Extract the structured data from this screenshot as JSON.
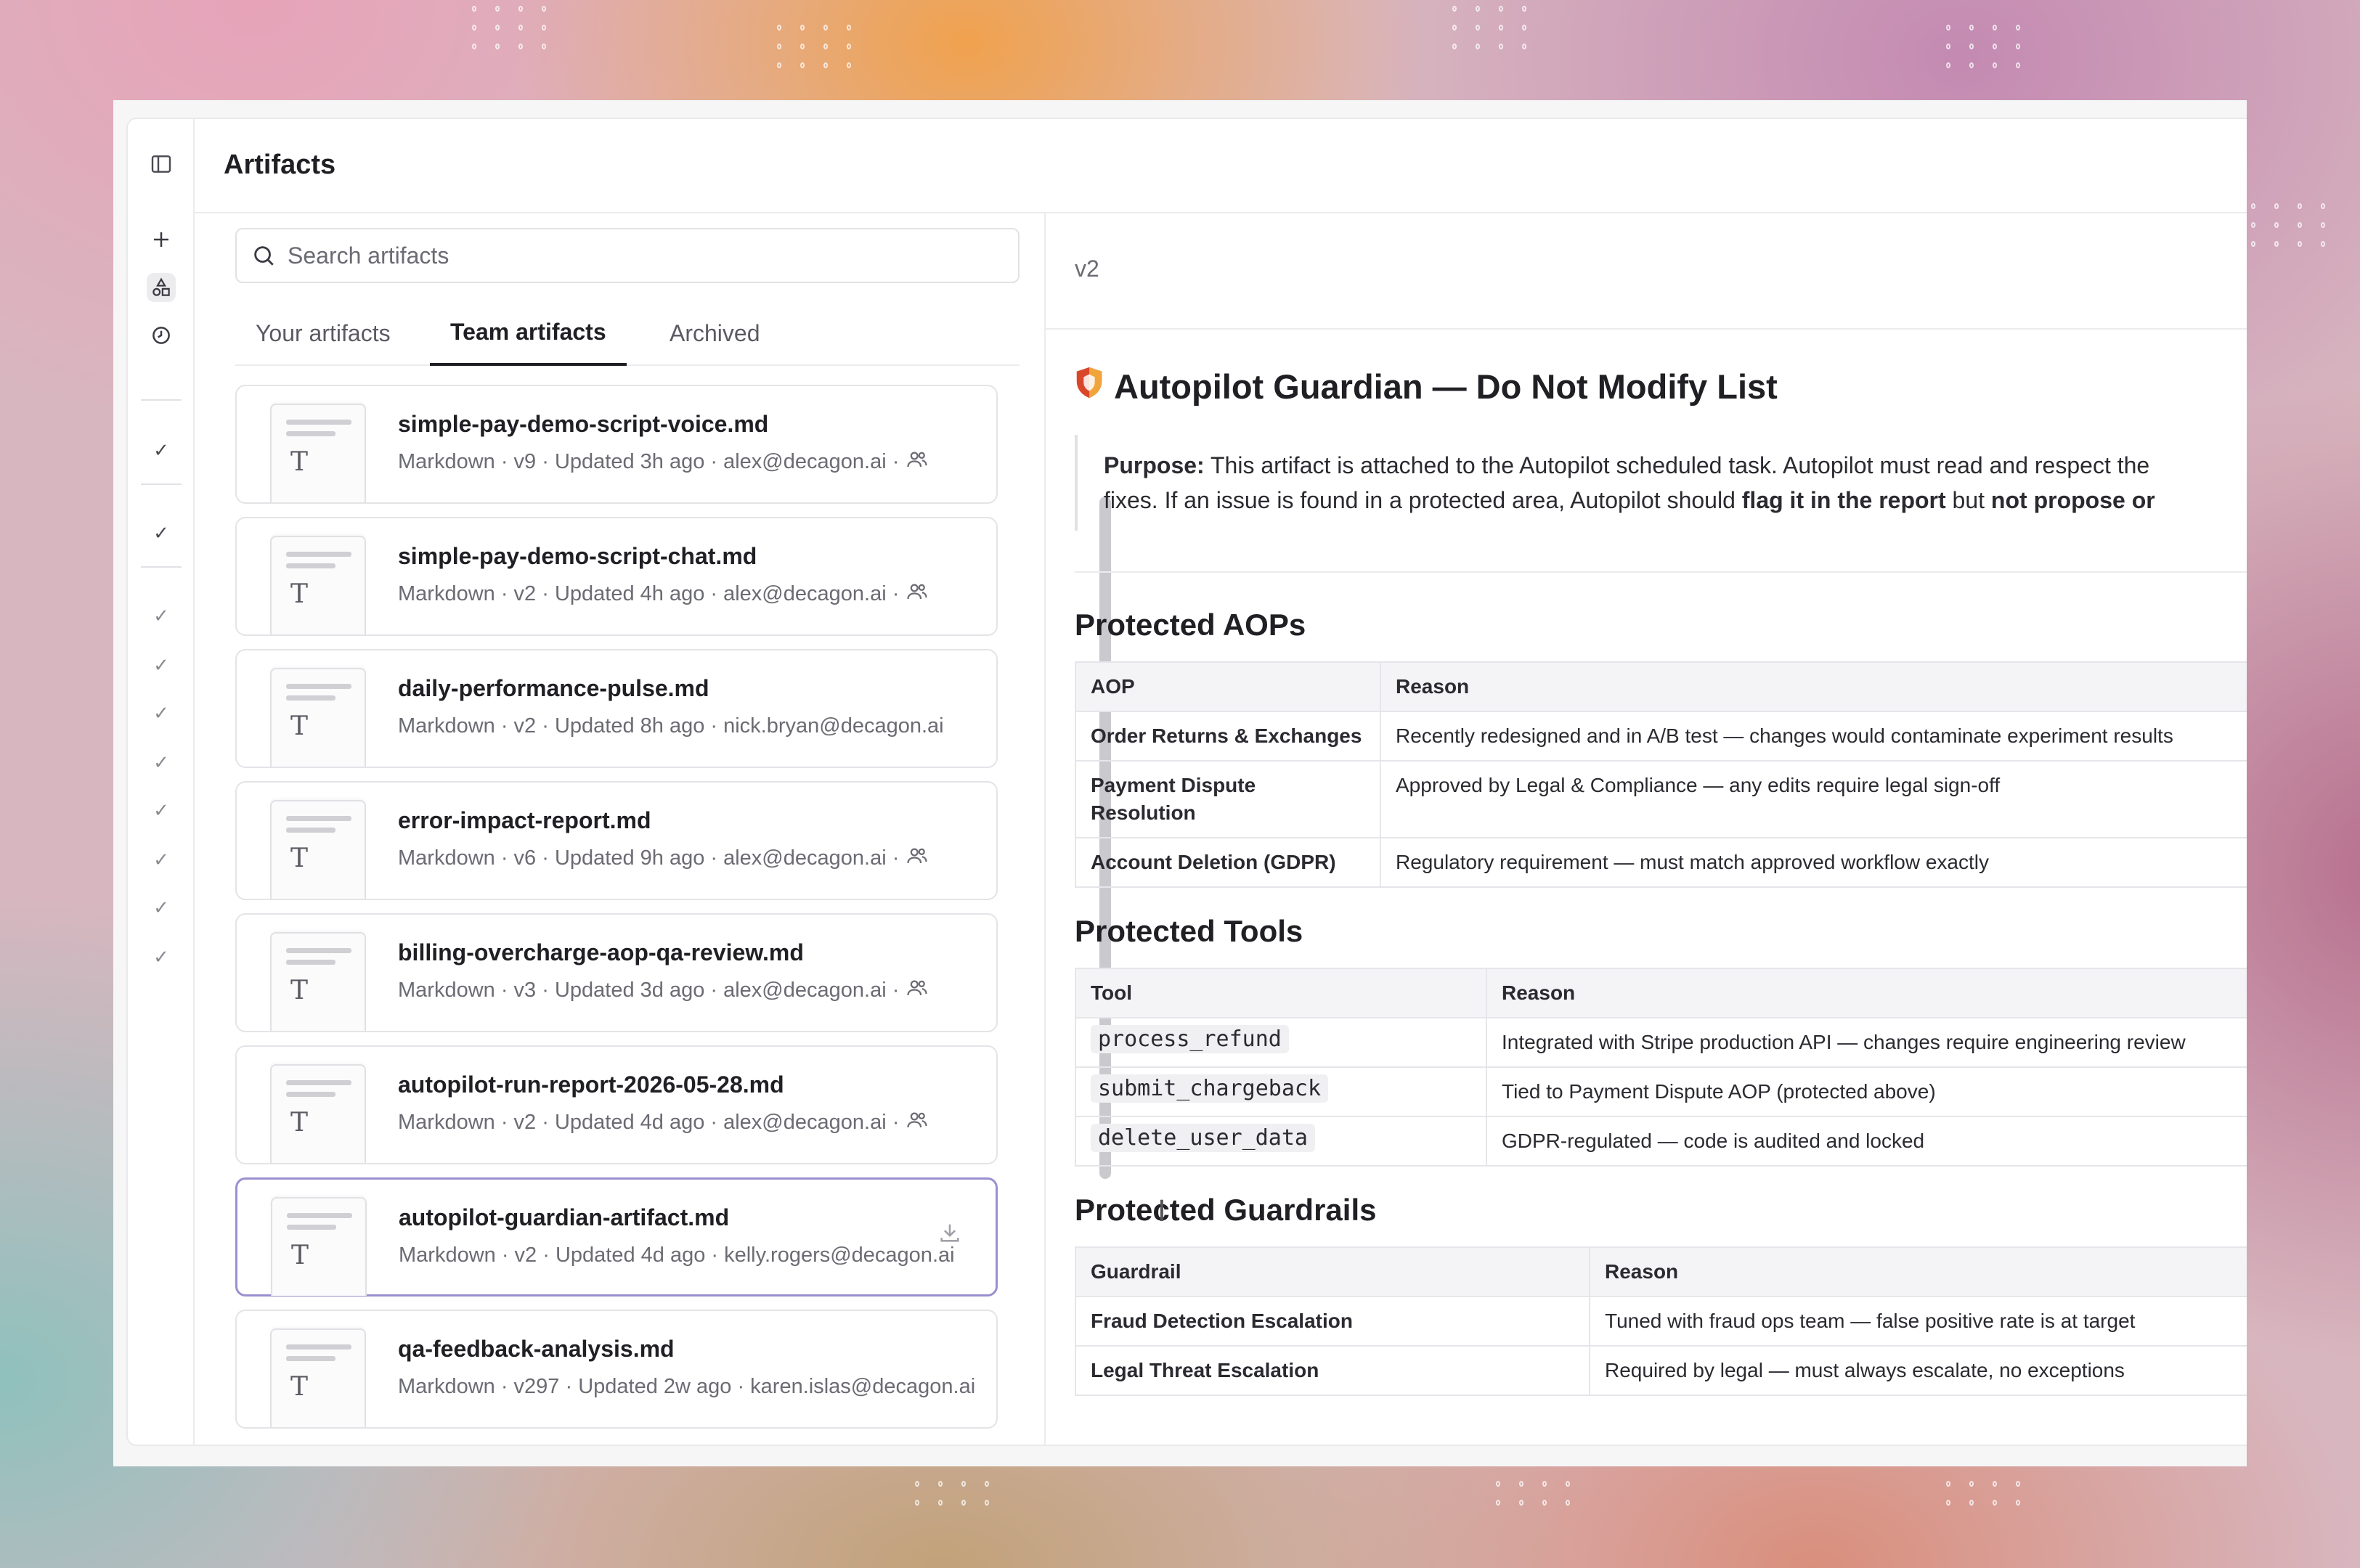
{
  "header": {
    "title": "Artifacts"
  },
  "search": {
    "placeholder": "Search artifacts"
  },
  "tabs": [
    {
      "label": "Your artifacts"
    },
    {
      "label": "Team artifacts",
      "active": true
    },
    {
      "label": "Archived"
    }
  ],
  "artifacts": [
    {
      "name": "simple-pay-demo-script-voice.md",
      "meta": "Markdown · v9 · Updated 3h ago · alex@decagon.ai ·",
      "shared": true
    },
    {
      "name": "simple-pay-demo-script-chat.md",
      "meta": "Markdown · v2 · Updated 4h ago · alex@decagon.ai ·",
      "shared": true
    },
    {
      "name": "daily-performance-pulse.md",
      "meta": "Markdown · v2 · Updated 8h ago · nick.bryan@decagon.ai",
      "shared": false
    },
    {
      "name": "error-impact-report.md",
      "meta": "Markdown · v6 · Updated 9h ago · alex@decagon.ai ·",
      "shared": true
    },
    {
      "name": "billing-overcharge-aop-qa-review.md",
      "meta": "Markdown · v3 · Updated 3d ago · alex@decagon.ai ·",
      "shared": true
    },
    {
      "name": "autopilot-run-report-2026-05-28.md",
      "meta": "Markdown · v2 · Updated 4d ago · alex@decagon.ai ·",
      "shared": true
    },
    {
      "name": "autopilot-guardian-artifact.md",
      "meta": "Markdown · v2 · Updated 4d ago · kelly.rogers@decagon.ai",
      "shared": false,
      "selected": true
    },
    {
      "name": "qa-feedback-analysis.md",
      "meta": "Markdown · v297 · Updated 2w ago · karen.islas@decagon.ai",
      "shared": false
    }
  ],
  "doc": {
    "version": "v2",
    "title": "Autopilot Guardian — Do Not Modify List",
    "purpose_label": "Purpose:",
    "purpose_line1": "This artifact is attached to the Autopilot scheduled task. Autopilot must read and respect the",
    "purpose_line2a": "fixes. If an issue is found in a protected area, Autopilot should ",
    "purpose_bold1": "flag it in the report",
    "purpose_line2b": " but ",
    "purpose_bold2": "not propose or",
    "aops": {
      "heading": "Protected AOPs",
      "columns": [
        "AOP",
        "Reason"
      ],
      "rows": [
        {
          "name": "Order Returns & Exchanges",
          "reason": "Recently redesigned and in A/B test — changes would contaminate experiment results"
        },
        {
          "name": "Payment Dispute Resolution",
          "reason": "Approved by Legal & Compliance — any edits require legal sign-off"
        },
        {
          "name": "Account Deletion (GDPR)",
          "reason": "Regulatory requirement — must match approved workflow exactly"
        }
      ]
    },
    "tools": {
      "heading": "Protected Tools",
      "columns": [
        "Tool",
        "Reason"
      ],
      "rows": [
        {
          "name": "process_refund",
          "reason": "Integrated with Stripe production API — changes require engineering review"
        },
        {
          "name": "submit_chargeback",
          "reason": "Tied to Payment Dispute AOP (protected above)"
        },
        {
          "name": "delete_user_data",
          "reason": "GDPR-regulated — code is audited and locked"
        }
      ]
    },
    "guardrails": {
      "heading": "Protected Guardrails",
      "columns": [
        "Guardrail",
        "Reason"
      ],
      "rows": [
        {
          "name": "Fraud Detection Escalation",
          "reason": "Tuned with fraud ops team — false positive rate is at target"
        },
        {
          "name": "Legal Threat Escalation",
          "reason": "Required by legal — must always escalate, no exceptions"
        }
      ]
    }
  }
}
